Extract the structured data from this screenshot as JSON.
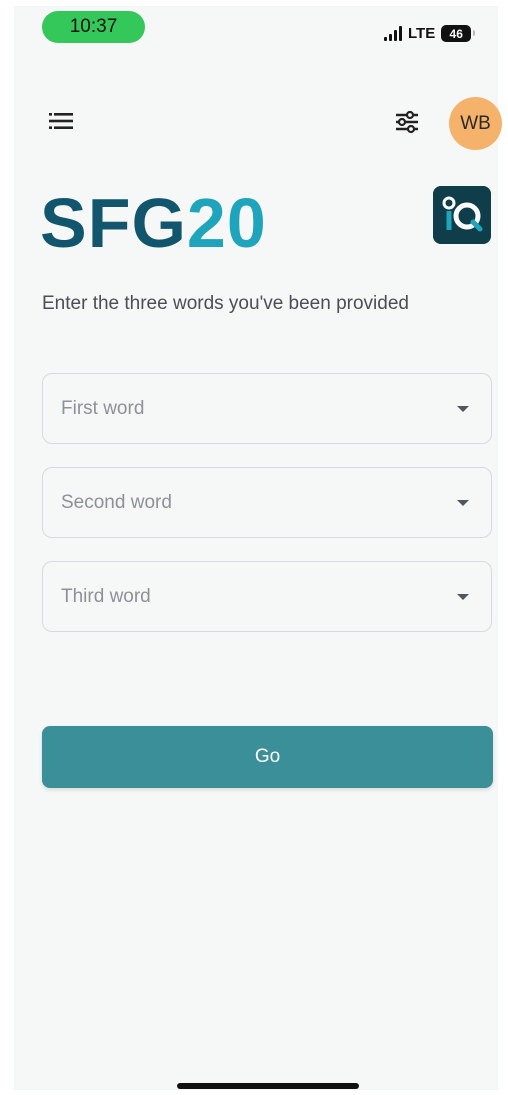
{
  "status_bar": {
    "time": "10:37",
    "network": "LTE",
    "battery": "46"
  },
  "header": {
    "avatar_initials": "WB"
  },
  "logo": {
    "part1": "SFG",
    "part2": "20"
  },
  "prompt": "Enter the three words you've been provided",
  "fields": [
    {
      "placeholder": "First word"
    },
    {
      "placeholder": "Second word"
    },
    {
      "placeholder": "Third word"
    }
  ],
  "go_button": {
    "label": "Go"
  },
  "colors": {
    "accent": "#3a8f98",
    "logo_dark": "#11566c",
    "logo_light": "#1ea5bb",
    "avatar_bg": "#f4b26b",
    "time_pill": "#34c759"
  }
}
